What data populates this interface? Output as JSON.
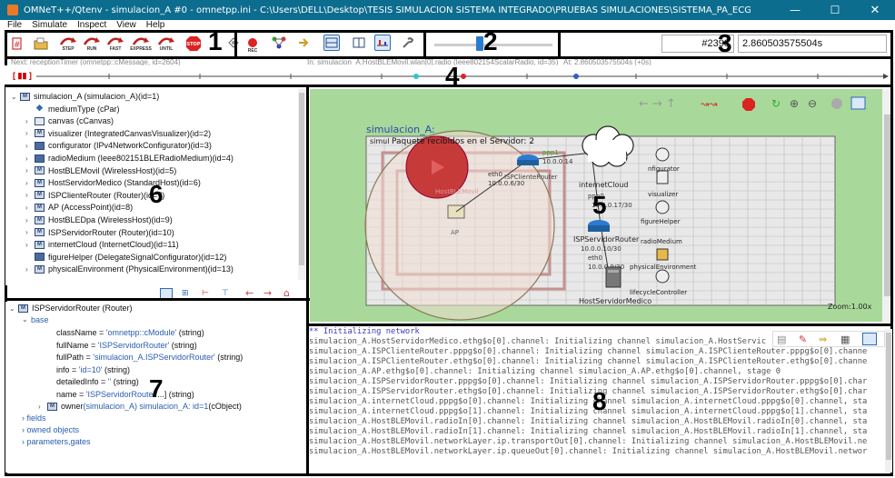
{
  "titlebar": {
    "title": "OMNeT++/Qtenv - simulacion_A #0 - omnetpp.ini - C:\\Users\\DELL\\Desktop\\TESIS SIMULACION SISTEMA INTEGRADO\\PRUEBAS SIMULACIONES\\SISTEMA_PA_ECG\\SISTEMA_PA_ECG\\inet\\examples\\sistema...",
    "minimize": "—",
    "maximize": "☐",
    "close": "✕"
  },
  "menu": [
    "File",
    "Simulate",
    "Inspect",
    "View",
    "Help"
  ],
  "toolbar": {
    "step": "STEP",
    "run": "RUN",
    "fast": "FAST",
    "express": "EXPRESS",
    "until": "UNTIL",
    "stop": "STOP",
    "rec": "REC",
    "event_number": "#2398",
    "sim_time": "2.860503575504s"
  },
  "info_bar": {
    "next": "Next: receptionTimer (omnetpp::cMessage, id=2604)",
    "in": "In: simulacion_A.HostBLEMovil.wlan[0].radio (Ieee802154ScalarRadio, id=35)",
    "at": "At: 2.860503575504s (+0s)"
  },
  "timeline": {
    "marker": "[ ▮▮ ]",
    "tick_labels": []
  },
  "tree": {
    "items": [
      {
        "chev": "⌄",
        "icon": "module",
        "text": "simulacion_A (simulacion_A)(id=1)"
      },
      {
        "chev": "",
        "icon": "param",
        "text": "mediumType (cPar)"
      },
      {
        "chev": "›",
        "icon": "canvas",
        "text": "canvas (cCanvas)"
      },
      {
        "chev": "›",
        "icon": "module",
        "text": "visualizer (IntegratedCanvasVisualizer)(id=2)"
      },
      {
        "chev": "›",
        "icon": "module-filled",
        "text": "configurator (IPv4NetworkConfigurator)(id=3)"
      },
      {
        "chev": "›",
        "icon": "module-filled",
        "text": "radioMedium (Ieee802151BLERadioMedium)(id=4)"
      },
      {
        "chev": "›",
        "icon": "module",
        "text": "HostBLEMovil (WirelessHost)(id=5)"
      },
      {
        "chev": "›",
        "icon": "module",
        "text": "HostServidorMedico (StandardHost)(id=6)"
      },
      {
        "chev": "›",
        "icon": "module",
        "text": "ISPClienteRouter (Router)(id=7)"
      },
      {
        "chev": "›",
        "icon": "module",
        "text": "AP (AccessPoint)(id=8)"
      },
      {
        "chev": "›",
        "icon": "module",
        "text": "HostBLEDpa (WirelessHost)(id=9)"
      },
      {
        "chev": "›",
        "icon": "module",
        "text": "ISPServidorRouter (Router)(id=10)"
      },
      {
        "chev": "›",
        "icon": "module",
        "text": "internetCloud (InternetCloud)(id=11)"
      },
      {
        "chev": "",
        "icon": "module-filled",
        "text": "figureHelper (DelegateSignalConfigurator)(id=12)"
      },
      {
        "chev": "›",
        "icon": "module",
        "text": "physicalEnvironment (PhysicalEnvironment)(id=13)"
      }
    ]
  },
  "inspector": {
    "header": "ISPServidorRouter (Router)",
    "group": "base",
    "rows": [
      {
        "k": "className = ",
        "v": "'omnetpp::cModule'",
        "t": " (string)"
      },
      {
        "k": "fullName = ",
        "v": "'ISPServidorRouter'",
        "t": " (string)"
      },
      {
        "k": "fullPath = ",
        "v": "'simulacion_A.ISPServidorRouter'",
        "t": " (string)"
      },
      {
        "k": "info = ",
        "v": "'id=10'",
        "t": " (string)"
      },
      {
        "k": "detailedInfo = ",
        "v": "''",
        "t": " (string)"
      },
      {
        "k": "name = ",
        "v": "'ISPServidorRouter'",
        "t": "...] (string)"
      }
    ],
    "owner_label": "owner ",
    "owner_value": "(simulacion_A) simulacion_A: id=1",
    "owner_type": " (cObject)",
    "collapsed": [
      "fields",
      "owned objects",
      "parameters,gates"
    ]
  },
  "canvas": {
    "network_title": "simulacion_A:",
    "status_prefix": "simul",
    "status_text": "Paquete recibidos en el Servidor: 2",
    "zoom": "Zoom:1.00x",
    "nodes": {
      "host_ble_movil": "HostBLEMovil",
      "ap": "AP",
      "isp_cliente": "ISPClienteRouter",
      "internet": "internetCloud",
      "isp_servidor": "ISPServidorRouter",
      "host_medico": "HostServidorMedico",
      "configurator": "nfigurator",
      "visualizer": "visualizer",
      "figure_helper": "figureHelper",
      "radio_medium": "radioMedium",
      "physical_env": "physicalEnvironment",
      "lifecycle": "lifecycleController"
    },
    "links": {
      "ppp1": "ppp1",
      "ip1": "10.0.0.14",
      "eth0": "eth0",
      "ip2": "10.0.0.6/30",
      "ip3": "10.0.0.17/30",
      "ppp0": "ppp0",
      "ip4": "10.0.0.10/30",
      "eth0b": "eth0",
      "ip5": "10.0.0.9/30"
    }
  },
  "log": {
    "lines": [
      "** Initializing network",
      "simulacion_A.HostServidorMedico.ethg$o[0].channel: Initializing channel simulacion_A.HostServic",
      "simulacion_A.ISPClienteRouter.pppg$o[0].channel: Initializing channel simulacion_A.ISPClienteRouter.pppg$o[0].channe",
      "simulacion_A.ISPClienteRouter.ethg$o[0].channel: Initializing channel simulacion_A.ISPClienteRouter.ethg$o[0].channe",
      "simulacion_A.AP.ethg$o[0].channel: Initializing channel simulacion_A.AP.ethg$o[0].channel, stage 0",
      "simulacion_A.ISPServidorRouter.pppg$o[0].channel: Initializing channel simulacion_A.ISPServidorRouter.pppg$o[0].char",
      "simulacion_A.ISPServidorRouter.ethg$o[0].channel: Initializing channel simulacion_A.ISPServidorRouter.ethg$o[0].char",
      "simulacion_A.internetCloud.pppg$o[0].channel: Initializing channel simulacion_A.internetCloud.pppg$o[0].channel, sta",
      "simulacion_A.internetCloud.pppg$o[1].channel: Initializing channel simulacion_A.internetCloud.pppg$o[1].channel, sta",
      "simulacion_A.HostBLEMovil.radioIn[0].channel: Initializing channel simulacion_A.HostBLEMovil.radioIn[0].channel, sta",
      "simulacion_A.HostBLEMovil.radioIn[1].channel: Initializing channel simulacion_A.HostBLEMovil.radioIn[1].channel, sta",
      "simulacion_A.HostBLEMovil.networkLayer.ip.transportOut[0].channel: Initializing channel simulacion_A.HostBLEMovil.ne",
      "simulacion_A.HostBLEMovil.networkLayer.ip.queueOut[0].channel: Initializing channel simulacion_A.HostBLEMovil.networ"
    ]
  },
  "annotations": [
    "1",
    "2",
    "3",
    "4",
    "5",
    "6",
    "7",
    "8"
  ],
  "colors": {
    "titlebar": "#0c6d8f",
    "canvas_bg": "#a8d99a",
    "log_text": "#555555",
    "log_header": "#3b3bbb",
    "tree_blue": "#2a5db0"
  }
}
